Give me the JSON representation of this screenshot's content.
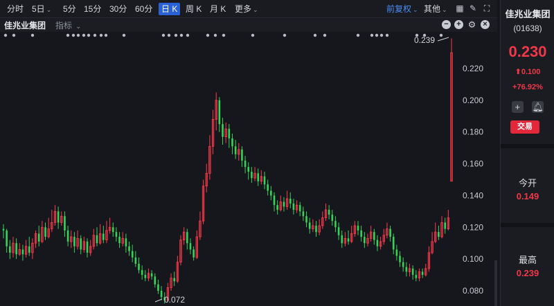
{
  "toolbar": {
    "left_items": [
      {
        "label": "分时"
      },
      {
        "label": "5日",
        "has_arrow": true
      },
      {
        "label": "5分"
      },
      {
        "label": "15分"
      },
      {
        "label": "30分"
      },
      {
        "label": "60分"
      },
      {
        "label": "日 K",
        "active": true
      },
      {
        "label": "周 K"
      },
      {
        "label": "月 K"
      },
      {
        "label": "更多",
        "has_arrow": true
      }
    ],
    "adjust_label": "前复权",
    "other_label": "其他",
    "icons": [
      "grid-icon",
      "brush-icon",
      "expand-icon"
    ]
  },
  "subbar": {
    "stock_name": "佳兆业集团",
    "indicator_label": "指标",
    "icons": [
      "minus-icon",
      "plus-icon",
      "settings-icon",
      "close-icon"
    ]
  },
  "side": {
    "name": "佳兆业集团",
    "code": "(01638)",
    "price": "0.230",
    "change": "0.100",
    "change_pct": "+76.92%",
    "trade_label": "交易",
    "open_label": "今开",
    "open_value": "0.149",
    "high_label": "最高",
    "high_value": "0.239"
  },
  "colors": {
    "up": "#ff3b4e",
    "down": "#36d35a",
    "accent": "#2a62d6",
    "background": "#16171c"
  },
  "chart_data": {
    "type": "candlestick",
    "y_ticks": [
      "0.220",
      "0.200",
      "0.180",
      "0.160",
      "0.140",
      "0.120",
      "0.100",
      "0.080"
    ],
    "ylim": [
      0.072,
      0.239
    ],
    "annotations": {
      "max_label": "0.239",
      "min_label": "0.072"
    },
    "candles": [
      [
        0.119,
        0.118,
        0.122,
        0.113
      ],
      [
        0.118,
        0.108,
        0.119,
        0.104
      ],
      [
        0.108,
        0.104,
        0.112,
        0.1
      ],
      [
        0.104,
        0.11,
        0.114,
        0.101
      ],
      [
        0.11,
        0.103,
        0.113,
        0.1
      ],
      [
        0.103,
        0.106,
        0.11,
        0.102
      ],
      [
        0.106,
        0.103,
        0.109,
        0.099
      ],
      [
        0.103,
        0.108,
        0.112,
        0.101
      ],
      [
        0.108,
        0.104,
        0.114,
        0.102
      ],
      [
        0.104,
        0.11,
        0.113,
        0.1
      ],
      [
        0.11,
        0.116,
        0.118,
        0.107
      ],
      [
        0.116,
        0.111,
        0.121,
        0.108
      ],
      [
        0.111,
        0.12,
        0.124,
        0.11
      ],
      [
        0.12,
        0.114,
        0.123,
        0.112
      ],
      [
        0.114,
        0.119,
        0.126,
        0.113
      ],
      [
        0.119,
        0.123,
        0.131,
        0.117
      ],
      [
        0.123,
        0.13,
        0.134,
        0.121
      ],
      [
        0.13,
        0.123,
        0.133,
        0.119
      ],
      [
        0.123,
        0.127,
        0.13,
        0.121
      ],
      [
        0.127,
        0.118,
        0.13,
        0.114
      ],
      [
        0.118,
        0.111,
        0.121,
        0.108
      ],
      [
        0.111,
        0.114,
        0.118,
        0.107
      ],
      [
        0.114,
        0.108,
        0.117,
        0.104
      ],
      [
        0.108,
        0.113,
        0.118,
        0.106
      ],
      [
        0.113,
        0.106,
        0.115,
        0.103
      ],
      [
        0.106,
        0.111,
        0.114,
        0.104
      ],
      [
        0.111,
        0.104,
        0.113,
        0.101
      ],
      [
        0.104,
        0.108,
        0.112,
        0.102
      ],
      [
        0.108,
        0.115,
        0.119,
        0.106
      ],
      [
        0.115,
        0.11,
        0.12,
        0.108
      ],
      [
        0.11,
        0.116,
        0.122,
        0.109
      ],
      [
        0.116,
        0.112,
        0.121,
        0.11
      ],
      [
        0.112,
        0.118,
        0.124,
        0.11
      ],
      [
        0.118,
        0.12,
        0.126,
        0.116
      ],
      [
        0.12,
        0.117,
        0.123,
        0.114
      ],
      [
        0.117,
        0.114,
        0.12,
        0.111
      ],
      [
        0.114,
        0.11,
        0.117,
        0.107
      ],
      [
        0.11,
        0.113,
        0.117,
        0.108
      ],
      [
        0.113,
        0.108,
        0.116,
        0.104
      ],
      [
        0.108,
        0.105,
        0.111,
        0.102
      ],
      [
        0.105,
        0.101,
        0.109,
        0.098
      ],
      [
        0.101,
        0.097,
        0.105,
        0.095
      ],
      [
        0.097,
        0.093,
        0.101,
        0.091
      ],
      [
        0.093,
        0.09,
        0.096,
        0.087
      ],
      [
        0.09,
        0.088,
        0.093,
        0.086
      ],
      [
        0.088,
        0.091,
        0.094,
        0.086
      ],
      [
        0.091,
        0.089,
        0.093,
        0.087
      ],
      [
        0.089,
        0.084,
        0.091,
        0.082
      ],
      [
        0.084,
        0.08,
        0.087,
        0.078
      ],
      [
        0.08,
        0.076,
        0.083,
        0.074
      ],
      [
        0.076,
        0.074,
        0.079,
        0.072
      ],
      [
        0.074,
        0.082,
        0.085,
        0.073
      ],
      [
        0.082,
        0.088,
        0.091,
        0.08
      ],
      [
        0.088,
        0.086,
        0.092,
        0.083
      ],
      [
        0.086,
        0.098,
        0.102,
        0.085
      ],
      [
        0.098,
        0.112,
        0.115,
        0.096
      ],
      [
        0.112,
        0.117,
        0.12,
        0.109
      ],
      [
        0.117,
        0.11,
        0.119,
        0.106
      ],
      [
        0.11,
        0.106,
        0.113,
        0.103
      ],
      [
        0.106,
        0.101,
        0.108,
        0.099
      ],
      [
        0.101,
        0.114,
        0.118,
        0.1
      ],
      [
        0.114,
        0.124,
        0.13,
        0.112
      ],
      [
        0.124,
        0.146,
        0.15,
        0.122
      ],
      [
        0.146,
        0.154,
        0.16,
        0.142
      ],
      [
        0.154,
        0.171,
        0.178,
        0.15
      ],
      [
        0.171,
        0.188,
        0.194,
        0.166
      ],
      [
        0.188,
        0.2,
        0.205,
        0.181
      ],
      [
        0.2,
        0.185,
        0.202,
        0.18
      ],
      [
        0.185,
        0.177,
        0.189,
        0.172
      ],
      [
        0.177,
        0.182,
        0.186,
        0.173
      ],
      [
        0.182,
        0.176,
        0.185,
        0.17
      ],
      [
        0.176,
        0.171,
        0.179,
        0.166
      ],
      [
        0.171,
        0.166,
        0.175,
        0.163
      ],
      [
        0.166,
        0.169,
        0.173,
        0.162
      ],
      [
        0.169,
        0.162,
        0.171,
        0.158
      ],
      [
        0.162,
        0.158,
        0.165,
        0.154
      ],
      [
        0.158,
        0.155,
        0.161,
        0.15
      ],
      [
        0.155,
        0.151,
        0.158,
        0.148
      ],
      [
        0.151,
        0.154,
        0.158,
        0.149
      ],
      [
        0.154,
        0.149,
        0.157,
        0.146
      ],
      [
        0.149,
        0.152,
        0.156,
        0.147
      ],
      [
        0.152,
        0.147,
        0.155,
        0.144
      ],
      [
        0.147,
        0.143,
        0.15,
        0.14
      ],
      [
        0.143,
        0.14,
        0.146,
        0.137
      ],
      [
        0.14,
        0.134,
        0.142,
        0.13
      ],
      [
        0.134,
        0.131,
        0.137,
        0.128
      ],
      [
        0.131,
        0.136,
        0.14,
        0.13
      ],
      [
        0.136,
        0.133,
        0.139,
        0.13
      ],
      [
        0.133,
        0.138,
        0.143,
        0.131
      ],
      [
        0.138,
        0.135,
        0.142,
        0.132
      ],
      [
        0.135,
        0.131,
        0.138,
        0.128
      ],
      [
        0.131,
        0.134,
        0.137,
        0.129
      ],
      [
        0.134,
        0.13,
        0.136,
        0.127
      ],
      [
        0.13,
        0.127,
        0.133,
        0.124
      ],
      [
        0.127,
        0.123,
        0.13,
        0.12
      ],
      [
        0.123,
        0.119,
        0.126,
        0.116
      ],
      [
        0.119,
        0.121,
        0.125,
        0.117
      ],
      [
        0.121,
        0.117,
        0.124,
        0.114
      ],
      [
        0.117,
        0.121,
        0.125,
        0.115
      ],
      [
        0.121,
        0.126,
        0.13,
        0.119
      ],
      [
        0.126,
        0.131,
        0.135,
        0.124
      ],
      [
        0.131,
        0.128,
        0.134,
        0.125
      ],
      [
        0.128,
        0.124,
        0.131,
        0.121
      ],
      [
        0.124,
        0.12,
        0.127,
        0.117
      ],
      [
        0.12,
        0.115,
        0.123,
        0.112
      ],
      [
        0.115,
        0.11,
        0.118,
        0.107
      ],
      [
        0.11,
        0.113,
        0.117,
        0.108
      ],
      [
        0.113,
        0.111,
        0.118,
        0.109
      ],
      [
        0.111,
        0.116,
        0.121,
        0.11
      ],
      [
        0.116,
        0.121,
        0.124,
        0.114
      ],
      [
        0.121,
        0.118,
        0.124,
        0.115
      ],
      [
        0.118,
        0.114,
        0.121,
        0.111
      ],
      [
        0.114,
        0.11,
        0.117,
        0.107
      ],
      [
        0.11,
        0.113,
        0.116,
        0.108
      ],
      [
        0.113,
        0.117,
        0.121,
        0.111
      ],
      [
        0.117,
        0.112,
        0.119,
        0.109
      ],
      [
        0.112,
        0.108,
        0.115,
        0.105
      ],
      [
        0.108,
        0.111,
        0.114,
        0.106
      ],
      [
        0.111,
        0.115,
        0.119,
        0.109
      ],
      [
        0.115,
        0.119,
        0.123,
        0.113
      ],
      [
        0.119,
        0.114,
        0.121,
        0.111
      ],
      [
        0.114,
        0.106,
        0.116,
        0.103
      ],
      [
        0.106,
        0.102,
        0.109,
        0.099
      ],
      [
        0.102,
        0.098,
        0.105,
        0.095
      ],
      [
        0.098,
        0.095,
        0.101,
        0.092
      ],
      [
        0.095,
        0.092,
        0.098,
        0.089
      ],
      [
        0.092,
        0.094,
        0.097,
        0.089
      ],
      [
        0.094,
        0.09,
        0.096,
        0.087
      ],
      [
        0.09,
        0.088,
        0.093,
        0.086
      ],
      [
        0.088,
        0.092,
        0.094,
        0.086
      ],
      [
        0.092,
        0.09,
        0.094,
        0.088
      ],
      [
        0.09,
        0.094,
        0.097,
        0.089
      ],
      [
        0.094,
        0.104,
        0.108,
        0.092
      ],
      [
        0.104,
        0.111,
        0.117,
        0.103
      ],
      [
        0.111,
        0.117,
        0.123,
        0.11
      ],
      [
        0.117,
        0.114,
        0.121,
        0.112
      ],
      [
        0.114,
        0.123,
        0.127,
        0.113
      ],
      [
        0.123,
        0.119,
        0.126,
        0.116
      ],
      [
        0.119,
        0.126,
        0.131,
        0.118
      ],
      [
        0.149,
        0.23,
        0.239,
        0.149
      ]
    ]
  }
}
